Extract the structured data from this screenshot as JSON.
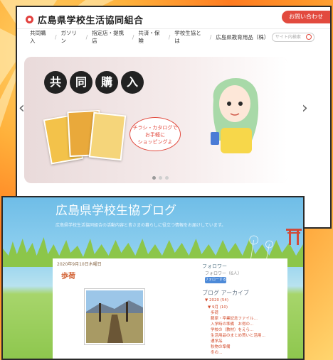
{
  "shop": {
    "logo_text": "広島県学校生活協同組合",
    "contact_button": "お問い合わせ",
    "nav": [
      "共同購入",
      "ガソリン",
      "指定店・提携店",
      "共済・保険",
      "学校生協とは",
      "広島県教育用品（株）"
    ],
    "search_placeholder": "サイト内検索",
    "banner": {
      "kyodo_chars": [
        "共",
        "同",
        "購",
        "入"
      ],
      "bubble_line1": "チラシ・カタログで",
      "bubble_line2": "お手軽に",
      "bubble_line3": "ショッピングよ"
    }
  },
  "blog": {
    "title": "広島県学校生協ブログ",
    "description": "広島県学校生活協同組合の活動内容と皆さまの暮らしに役立つ情報をお届けしています。",
    "post_date": "2020年9月10日木曜日",
    "post_title": "歩荷",
    "sidebar": {
      "followers_title": "フォロワー",
      "followers_sub": "フォロワー（6人）",
      "follow_button": "フォローする",
      "archive_title": "ブログ アーカイブ",
      "archive_items": [
        "▼ 2020 (54)",
        "▼ 9月 (10)",
        "歩荷",
        "藤原・卒業記念ファイル…",
        "入学時の準備　お得の…",
        "学校の（教材）をえら…",
        "生活用品のまとめ買いと活用…",
        "通学品",
        "秋物の準備",
        "冬の…"
      ]
    }
  },
  "colors": {
    "accent_red": "#e24a3e",
    "blog_sky": "#6fbde7",
    "grass": "#8ec74e"
  }
}
